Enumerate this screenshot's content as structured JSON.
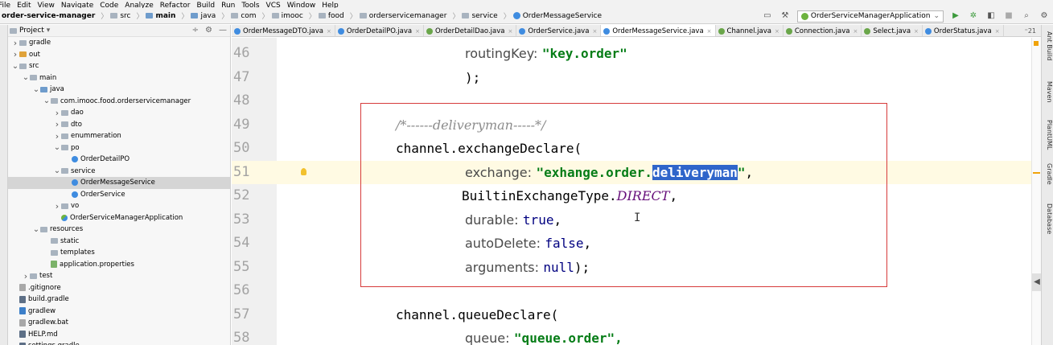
{
  "menu": [
    "File",
    "Edit",
    "View",
    "Navigate",
    "Code",
    "Analyze",
    "Refactor",
    "Build",
    "Run",
    "Tools",
    "VCS",
    "Window",
    "Help"
  ],
  "breadcrumb": [
    "order-service-manager",
    "src",
    "main",
    "java",
    "com",
    "imooc",
    "food",
    "orderservicemanager",
    "service",
    "OrderMessageService"
  ],
  "run_config": "OrderServiceManagerApplication",
  "project_panel": {
    "title": "Project",
    "tree": [
      {
        "label": "gradle",
        "arrow": "right",
        "icon": "folder",
        "indent": 0
      },
      {
        "label": "out",
        "arrow": "right",
        "icon": "folder-orange",
        "indent": 0
      },
      {
        "label": "src",
        "arrow": "down",
        "icon": "folder",
        "indent": 0
      },
      {
        "label": "main",
        "arrow": "down",
        "icon": "folder",
        "indent": 1
      },
      {
        "label": "java",
        "arrow": "down",
        "icon": "folder-blue",
        "indent": 2
      },
      {
        "label": "com.imooc.food.orderservicemanager",
        "arrow": "down",
        "icon": "folder",
        "indent": 3
      },
      {
        "label": "dao",
        "arrow": "right",
        "icon": "folder",
        "indent": 4
      },
      {
        "label": "dto",
        "arrow": "right",
        "icon": "folder",
        "indent": 4
      },
      {
        "label": "enummeration",
        "arrow": "right",
        "icon": "folder",
        "indent": 4
      },
      {
        "label": "po",
        "arrow": "down",
        "icon": "folder",
        "indent": 4
      },
      {
        "label": "OrderDetailPO",
        "arrow": "",
        "icon": "class",
        "indent": 5
      },
      {
        "label": "service",
        "arrow": "down",
        "icon": "folder",
        "indent": 4
      },
      {
        "label": "OrderMessageService",
        "arrow": "",
        "icon": "class",
        "indent": 5,
        "selected": true
      },
      {
        "label": "OrderService",
        "arrow": "",
        "icon": "class",
        "indent": 5
      },
      {
        "label": "vo",
        "arrow": "right",
        "icon": "folder",
        "indent": 4
      },
      {
        "label": "OrderServiceManagerApplication",
        "arrow": "",
        "icon": "spring-class",
        "indent": 4
      },
      {
        "label": "resources",
        "arrow": "down",
        "icon": "folder",
        "indent": 2
      },
      {
        "label": "static",
        "arrow": "",
        "icon": "folder",
        "indent": 3
      },
      {
        "label": "templates",
        "arrow": "",
        "icon": "folder",
        "indent": 3
      },
      {
        "label": "application.properties",
        "arrow": "",
        "icon": "properties",
        "indent": 3
      },
      {
        "label": "test",
        "arrow": "right",
        "icon": "folder",
        "indent": 1
      },
      {
        "label": ".gitignore",
        "arrow": "",
        "icon": "file",
        "indent": 0
      },
      {
        "label": "build.gradle",
        "arrow": "",
        "icon": "gradle-file",
        "indent": 0
      },
      {
        "label": "gradlew",
        "arrow": "",
        "icon": "script",
        "indent": 0
      },
      {
        "label": "gradlew.bat",
        "arrow": "",
        "icon": "file",
        "indent": 0
      },
      {
        "label": "HELP.md",
        "arrow": "",
        "icon": "markdown",
        "indent": 0
      },
      {
        "label": "settings.gradle",
        "arrow": "",
        "icon": "gradle-file",
        "indent": 0
      }
    ]
  },
  "tabs": [
    {
      "label": "OrderMessageDTO.java",
      "icon": "c"
    },
    {
      "label": "OrderDetailPO.java",
      "icon": "c"
    },
    {
      "label": "OrderDetailDao.java",
      "icon": "i"
    },
    {
      "label": "OrderService.java",
      "icon": "c"
    },
    {
      "label": "OrderMessageService.java",
      "icon": "c",
      "active": true
    },
    {
      "label": "Channel.java",
      "icon": "i"
    },
    {
      "label": "Connection.java",
      "icon": "i"
    },
    {
      "label": "Select.java",
      "icon": "i"
    },
    {
      "label": "OrderStatus.java",
      "icon": "e"
    }
  ],
  "tabs_more": "⁼21",
  "editor": {
    "line_numbers": [
      "46",
      "47",
      "48",
      "49",
      "50",
      "51",
      "52",
      "53",
      "54",
      "55",
      "56",
      "57",
      "58"
    ],
    "l46_label": "routingKey:",
    "l46_str": "\"key.order\"",
    "l47": ");",
    "l49": "/*------deliveryman-----*/",
    "l50": "channel.exchangeDeclare(",
    "l51_label": "exchange:",
    "l51_str_a": "\"exhange.order.",
    "l51_sel": "deliveryman",
    "l51_str_b": "\"",
    "l51_comma": ",",
    "l52_plain": "BuiltinExchangeType.",
    "l52_enum": "DIRECT",
    "l52_comma": ",",
    "l53_label": "durable:",
    "l53_val": "true",
    "l53_comma": ",",
    "l54_label": "autoDelete:",
    "l54_val": "false",
    "l54_comma": ",",
    "l55_label": "arguments:",
    "l55_val": "null",
    "l55_end": ");",
    "l57": "channel.queueDeclare(",
    "l58_label": "queue:",
    "l58_str": "\"queue.order\","
  },
  "right_tools": [
    "Ant Build",
    "Maven",
    "PlantUML",
    "Gradle",
    "Database"
  ]
}
